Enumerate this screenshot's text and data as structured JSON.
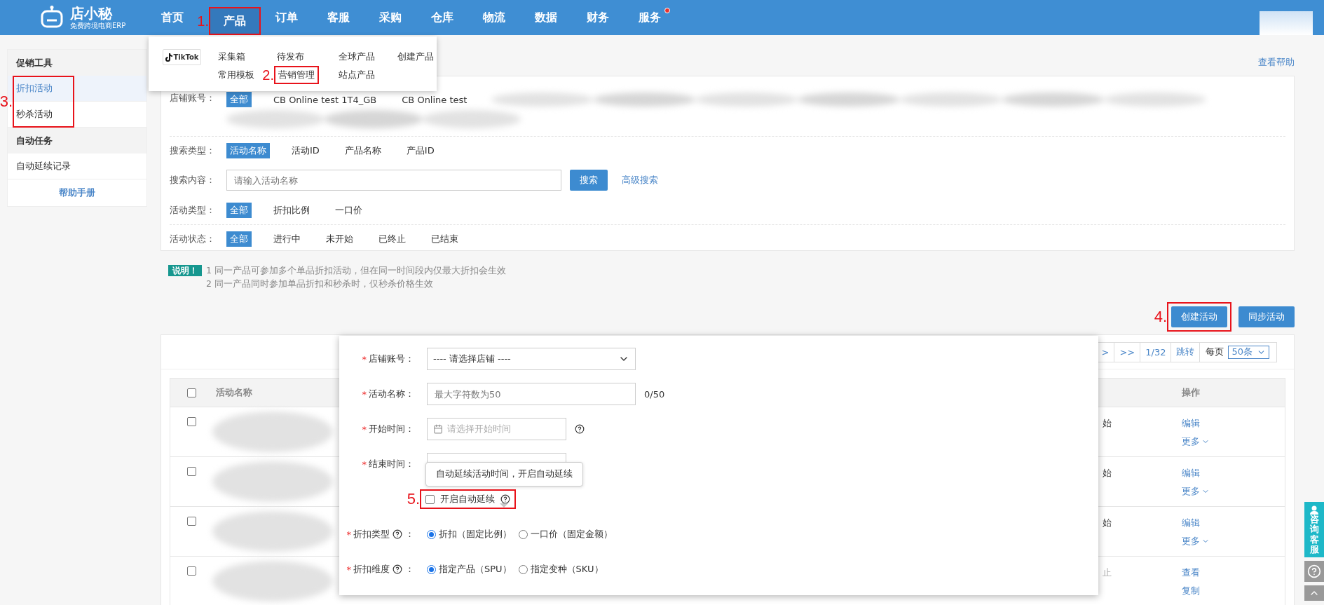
{
  "logo": {
    "name": "店小秘",
    "tagline": "免费跨境电商ERP"
  },
  "nav": [
    {
      "label": "首页",
      "selected": false,
      "notify": false
    },
    {
      "label": "产品",
      "selected": true,
      "notify": false,
      "annotation": "1."
    },
    {
      "label": "订单",
      "selected": false,
      "notify": false
    },
    {
      "label": "客服",
      "selected": false,
      "notify": false
    },
    {
      "label": "采购",
      "selected": false,
      "notify": false
    },
    {
      "label": "仓库",
      "selected": false,
      "notify": false
    },
    {
      "label": "物流",
      "selected": false,
      "notify": false
    },
    {
      "label": "数据",
      "selected": false,
      "notify": false
    },
    {
      "label": "财务",
      "selected": false,
      "notify": false
    },
    {
      "label": "服务",
      "selected": false,
      "notify": true
    }
  ],
  "product_menu": {
    "platform": "TikTok",
    "items": [
      {
        "label": "采集箱"
      },
      {
        "label": "待发布"
      },
      {
        "label": "全球产品"
      },
      {
        "label": "创建产品"
      },
      {
        "label": "常用模板"
      },
      {
        "label": "营销管理",
        "annotation": "2."
      },
      {
        "label": "站点产品"
      }
    ]
  },
  "sidebar": {
    "groups": [
      {
        "title": "促销工具",
        "annotation": "3.",
        "items": [
          {
            "label": "折扣活动",
            "selected": true
          },
          {
            "label": "秒杀活动",
            "selected": false
          }
        ]
      },
      {
        "title": "自动任务",
        "items": [
          {
            "label": "自动延续记录",
            "selected": false
          }
        ]
      }
    ],
    "help": "帮助手册"
  },
  "help_link": "查看帮助",
  "filters": [
    {
      "kind": "accounts",
      "label": "店铺账号：",
      "options": [
        {
          "label": "全部",
          "selected": true
        },
        {
          "label": "CB Online test 1T4_GB",
          "selected": false
        },
        {
          "label": "CB Online test",
          "selected": false
        }
      ]
    },
    {
      "kind": "options",
      "label": "搜索类型：",
      "options": [
        {
          "label": "活动名称",
          "selected": true
        },
        {
          "label": "活动ID",
          "selected": false
        },
        {
          "label": "产品名称",
          "selected": false
        },
        {
          "label": "产品ID",
          "selected": false
        }
      ]
    },
    {
      "kind": "search",
      "label": "搜索内容：",
      "placeholder": "请输入活动名称",
      "button": "搜索",
      "advanced": "高级搜索"
    },
    {
      "kind": "options",
      "label": "活动类型：",
      "options": [
        {
          "label": "全部",
          "selected": true
        },
        {
          "label": "折扣比例",
          "selected": false
        },
        {
          "label": "一口价",
          "selected": false
        }
      ]
    },
    {
      "kind": "options",
      "label": "活动状态：",
      "options": [
        {
          "label": "全部",
          "selected": true
        },
        {
          "label": "进行中",
          "selected": false
        },
        {
          "label": "未开始",
          "selected": false
        },
        {
          "label": "已终止",
          "selected": false
        },
        {
          "label": "已结束",
          "selected": false
        }
      ]
    }
  ],
  "notice": {
    "tag": "说明！",
    "lines": [
      "1 同一产品可参加多个单品折扣活动，但在同一时间段内仅最大折扣会生效",
      "2 同一产品同时参加单品折扣和秒杀时，仅秒杀价格生效"
    ]
  },
  "actions": [
    {
      "label": "创建活动",
      "annotation": "4."
    },
    {
      "label": "同步活动"
    }
  ],
  "pagination": {
    "buttons": [
      ">",
      ">>",
      "1/32",
      "跳转"
    ],
    "per_page_label": "每页",
    "per_page": "50条"
  },
  "table": {
    "header_checked": false,
    "columns": [
      "活动名称",
      "操作"
    ],
    "rows": [
      {
        "checked": false,
        "status": "始",
        "muted": false,
        "actions": [
          {
            "label": "编辑",
            "kind": "link"
          },
          {
            "label": "更多",
            "kind": "menu"
          }
        ]
      },
      {
        "checked": false,
        "status": "始",
        "muted": false,
        "actions": [
          {
            "label": "编辑",
            "kind": "link"
          },
          {
            "label": "更多",
            "kind": "menu"
          }
        ]
      },
      {
        "checked": false,
        "status": "始",
        "muted": false,
        "actions": [
          {
            "label": "编辑",
            "kind": "link"
          },
          {
            "label": "更多",
            "kind": "menu"
          }
        ]
      },
      {
        "checked": false,
        "status": "止",
        "muted": true,
        "actions": [
          {
            "label": "查看",
            "kind": "link"
          },
          {
            "label": "复制",
            "kind": "link"
          }
        ]
      }
    ]
  },
  "modal": {
    "fields": [
      {
        "kind": "select",
        "mark": "*",
        "label": "店铺账号：",
        "value": "---- 请选择店铺 ----"
      },
      {
        "kind": "text",
        "mark": "*",
        "label": "活动名称：",
        "placeholder": "最大字符数为50",
        "counter": "0/50"
      },
      {
        "kind": "date",
        "mark": "*",
        "label": "开始时间：",
        "placeholder": "请选择开始时间",
        "help": true
      },
      {
        "kind": "date",
        "mark": "*",
        "label": "结束时间："
      },
      {
        "kind": "checkbox",
        "label": "开启自动延续",
        "checked": false,
        "help": true,
        "annotation": "5.",
        "tooltip": "自动延续活动时间，开启自动延续"
      },
      {
        "kind": "radio",
        "mark": "*",
        "label": "折扣类型",
        "help": true,
        "suffix": "：",
        "options": [
          {
            "label": "折扣（固定比例）",
            "selected": true
          },
          {
            "label": "一口价（固定金额）",
            "selected": false
          }
        ]
      },
      {
        "kind": "radio",
        "mark": "*",
        "label": "折扣维度",
        "help": true,
        "suffix": "：",
        "options": [
          {
            "label": "指定产品（SPU）",
            "selected": true
          },
          {
            "label": "指定变种（SKU）",
            "selected": false
          }
        ]
      }
    ]
  },
  "widget": {
    "label": "咨询客服"
  }
}
